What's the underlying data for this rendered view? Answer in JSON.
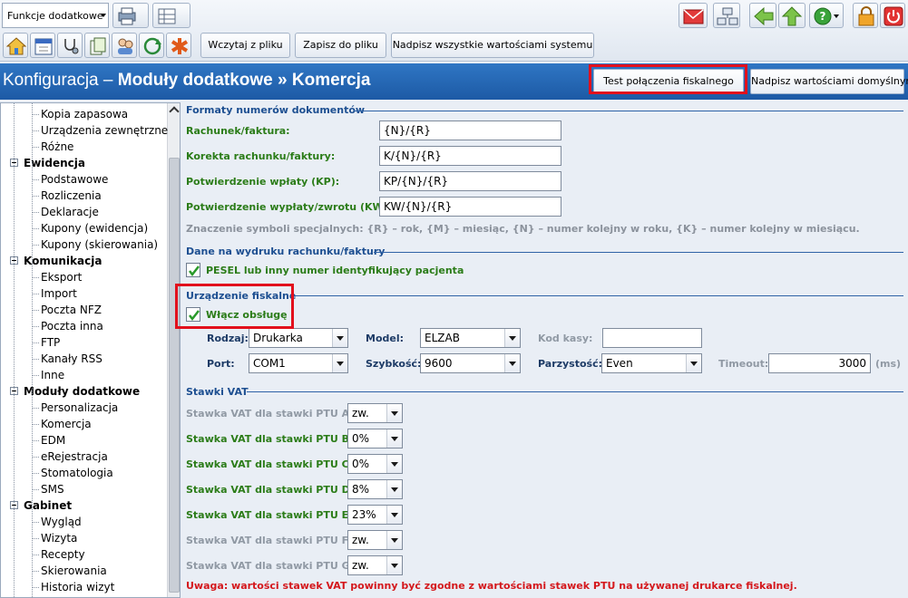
{
  "toolbar": {
    "functions_combo": "Funkcje dodatkowe",
    "load_button": "Wczytaj z pliku",
    "save_button": "Zapisz do pliku",
    "overwrite_system_button": "Nadpisz wszystkie wartościami systemu"
  },
  "header": {
    "title_prefix": "Konfiguracja – ",
    "title_bold": "Moduły dodatkowe » Komercja",
    "test_fiscal_button": "Test połączenia fiskalnego",
    "overwrite_default_button": "Nadpisz wartościami domyślnymi"
  },
  "tree": {
    "items": [
      {
        "label": "Kopia zapasowa",
        "type": "child"
      },
      {
        "label": "Urządzenia zewnętrzne",
        "type": "child"
      },
      {
        "label": "Różne",
        "type": "child"
      },
      {
        "label": "Ewidencja",
        "type": "cat"
      },
      {
        "label": "Podstawowe",
        "type": "child"
      },
      {
        "label": "Rozliczenia",
        "type": "child"
      },
      {
        "label": "Deklaracje",
        "type": "child"
      },
      {
        "label": "Kupony (ewidencja)",
        "type": "child"
      },
      {
        "label": "Kupony (skierowania)",
        "type": "child"
      },
      {
        "label": "Komunikacja",
        "type": "cat"
      },
      {
        "label": "Eksport",
        "type": "child"
      },
      {
        "label": "Import",
        "type": "child"
      },
      {
        "label": "Poczta NFZ",
        "type": "child"
      },
      {
        "label": "Poczta inna",
        "type": "child"
      },
      {
        "label": "FTP",
        "type": "child"
      },
      {
        "label": "Kanały RSS",
        "type": "child"
      },
      {
        "label": "Inne",
        "type": "child"
      },
      {
        "label": "Moduły dodatkowe",
        "type": "cat"
      },
      {
        "label": "Personalizacja",
        "type": "child"
      },
      {
        "label": "Komercja",
        "type": "child"
      },
      {
        "label": "EDM",
        "type": "child"
      },
      {
        "label": "eRejestracja",
        "type": "child"
      },
      {
        "label": "Stomatologia",
        "type": "child"
      },
      {
        "label": "SMS",
        "type": "child"
      },
      {
        "label": "Gabinet",
        "type": "cat"
      },
      {
        "label": "Wygląd",
        "type": "child"
      },
      {
        "label": "Wizyta",
        "type": "child"
      },
      {
        "label": "Recepty",
        "type": "child"
      },
      {
        "label": "Skierowania",
        "type": "child"
      },
      {
        "label": "Historia wizyt",
        "type": "child"
      }
    ]
  },
  "formats": {
    "section": "Formaty numerów dokumentów",
    "invoice_label": "Rachunek/faktura:",
    "invoice_value": "{N}/{R}",
    "correction_label": "Korekta rachunku/faktury:",
    "correction_value": "K/{N}/{R}",
    "kp_label": "Potwierdzenie wpłaty (KP):",
    "kp_value": "KP/{N}/{R}",
    "kw_label": "Potwierdzenie wypłaty/zwrotu (KW):",
    "kw_value": "KW/{N}/{R}",
    "note": "Znaczenie symboli specjalnych: {R} – rok, {M} – miesiąc, {N} – numer kolejny w roku, {K} – numer kolejny w miesiącu."
  },
  "printout": {
    "section": "Dane na wydruku rachunku/faktury",
    "pesel_label": "PESEL lub inny numer identyfikujący pacjenta"
  },
  "fiscal": {
    "section": "Urządzenie fiskalne",
    "enable_label": "Włącz obsługę",
    "type_label": "Rodzaj:",
    "type_value": "Drukarka",
    "model_label": "Model:",
    "model_value": "ELZAB",
    "cash_code_label": "Kod kasy:",
    "cash_code_value": "",
    "port_label": "Port:",
    "port_value": "COM1",
    "speed_label": "Szybkość:",
    "speed_value": "9600",
    "parity_label": "Parzystość:",
    "parity_value": "Even",
    "timeout_label": "Timeout:",
    "timeout_value": "3000",
    "timeout_unit": "(ms)"
  },
  "vat": {
    "section": "Stawki VAT",
    "rows": [
      {
        "label": "Stawka VAT dla stawki PTU A:",
        "value": "zw."
      },
      {
        "label": "Stawka VAT dla stawki PTU B:",
        "value": "0%"
      },
      {
        "label": "Stawka VAT dla stawki PTU C:",
        "value": "0%"
      },
      {
        "label": "Stawka VAT dla stawki PTU D:",
        "value": "8%"
      },
      {
        "label": "Stawka VAT dla stawki PTU E:",
        "value": "23%"
      },
      {
        "label": "Stawka VAT dla stawki PTU F:",
        "value": "zw."
      },
      {
        "label": "Stawka VAT dla stawki PTU G:",
        "value": "zw."
      }
    ],
    "warning": "Uwaga: wartości stawek VAT powinny być zgodne z wartościami stawek PTU na używanej drukarce fiskalnej."
  },
  "colors": {
    "header_blue": "#1d5aa5",
    "label_green": "#2b7c18",
    "section_blue": "#1d4f91",
    "warning_red": "#d4181c",
    "highlight_red": "#e2101c"
  }
}
